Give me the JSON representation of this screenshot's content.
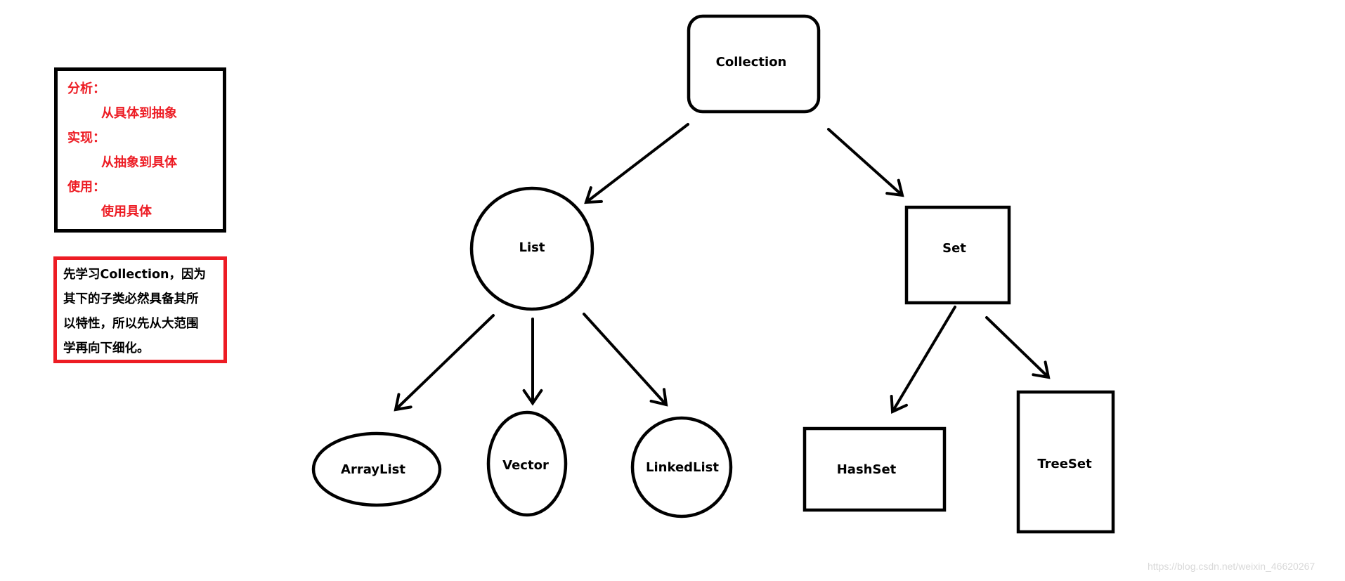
{
  "analysis_note": {
    "lines": [
      "分析：",
      "从具体到抽象",
      "实现：",
      "从抽象到具体",
      "使用：",
      "使用具体"
    ],
    "color": "#ed1c24"
  },
  "study_note": {
    "lines": [
      "先学习Collection，因为",
      "其下的子类必然具备其所",
      "以特性，所以先从大范围",
      "学再向下细化。"
    ],
    "border_color": "#ed1c24"
  },
  "nodes": {
    "collection": "Collection",
    "list": "List",
    "set": "Set",
    "arraylist": "ArrayList",
    "vector": "Vector",
    "linkedlist": "LinkedList",
    "hashset": "HashSet",
    "treeset": "TreeSet"
  },
  "edges": [
    [
      "Collection",
      "List"
    ],
    [
      "Collection",
      "Set"
    ],
    [
      "List",
      "ArrayList"
    ],
    [
      "List",
      "Vector"
    ],
    [
      "List",
      "LinkedList"
    ],
    [
      "Set",
      "HashSet"
    ],
    [
      "Set",
      "TreeSet"
    ]
  ],
  "watermark": "https://blog.csdn.net/weixin_46620267"
}
